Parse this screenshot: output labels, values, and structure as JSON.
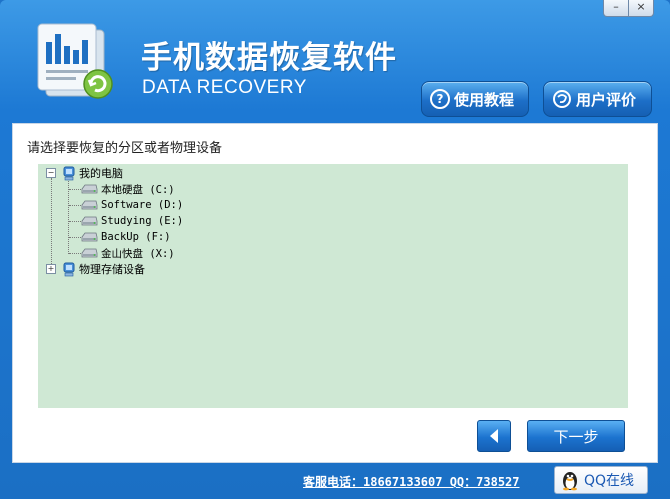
{
  "window": {
    "minimize_glyph": "–",
    "close_glyph": "×"
  },
  "header": {
    "title_cn": "手机数据恢复软件",
    "title_en": "DATA RECOVERY",
    "tutorial_label": "使用教程",
    "review_label": "用户评价"
  },
  "main": {
    "prompt": "请选择要恢复的分区或者物理设备",
    "tree": {
      "root": {
        "label": "我的电脑",
        "expander": "−"
      },
      "drives": [
        {
          "label": "本地硬盘 (C:)"
        },
        {
          "label": "Software (D:)"
        },
        {
          "label": "Studying (E:)"
        },
        {
          "label": "BackUp (F:)"
        },
        {
          "label": "金山快盘 (X:)"
        }
      ],
      "physical": {
        "label": "物理存储设备",
        "expander": "+"
      }
    }
  },
  "nav": {
    "next_label": "下一步"
  },
  "footer": {
    "phone_text": "客服电话：18667133607 QQ：738527",
    "qq_label": "QQ在线"
  },
  "colors": {
    "brand_blue": "#1d79d4",
    "tree_background": "#cfe8d4"
  }
}
